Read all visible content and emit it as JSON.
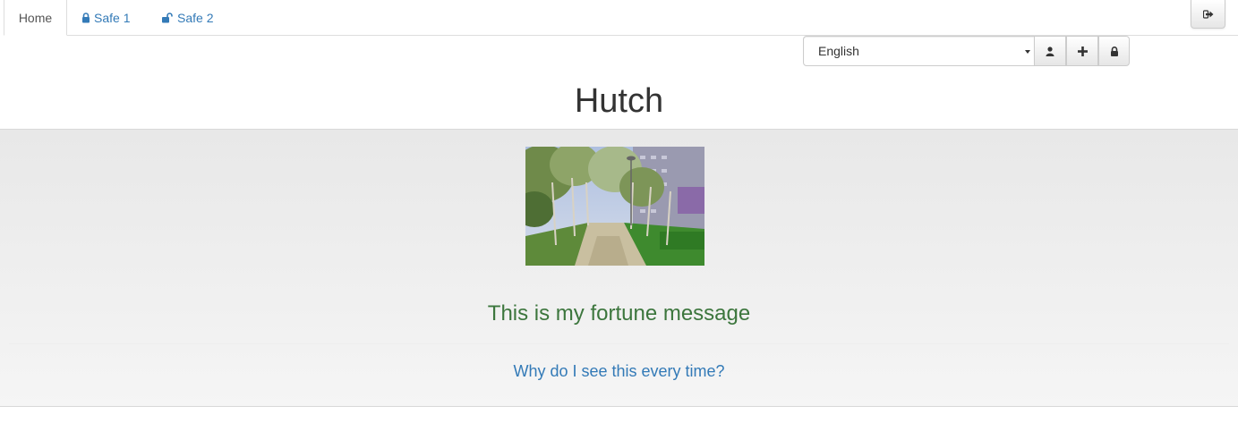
{
  "tabs": [
    {
      "label": "Home",
      "icon": "",
      "active": true
    },
    {
      "label": "Safe 1",
      "icon": "lock-icon",
      "active": false
    },
    {
      "label": "Safe 2",
      "icon": "unlock-icon",
      "active": false
    }
  ],
  "toolbar": {
    "language_selected": "English",
    "user_icon": "user-icon",
    "add_icon": "plus-icon",
    "lock_icon": "lock-icon",
    "logout_icon": "sign-out-icon"
  },
  "header": {
    "title": "Hutch"
  },
  "main": {
    "photo_description": "tree-lined park path",
    "fortune_message": "This is my fortune message",
    "why_link": "Why do I see this every time?"
  },
  "colors": {
    "link": "#337ab7",
    "fortune": "#3c763d",
    "text": "#333333"
  }
}
